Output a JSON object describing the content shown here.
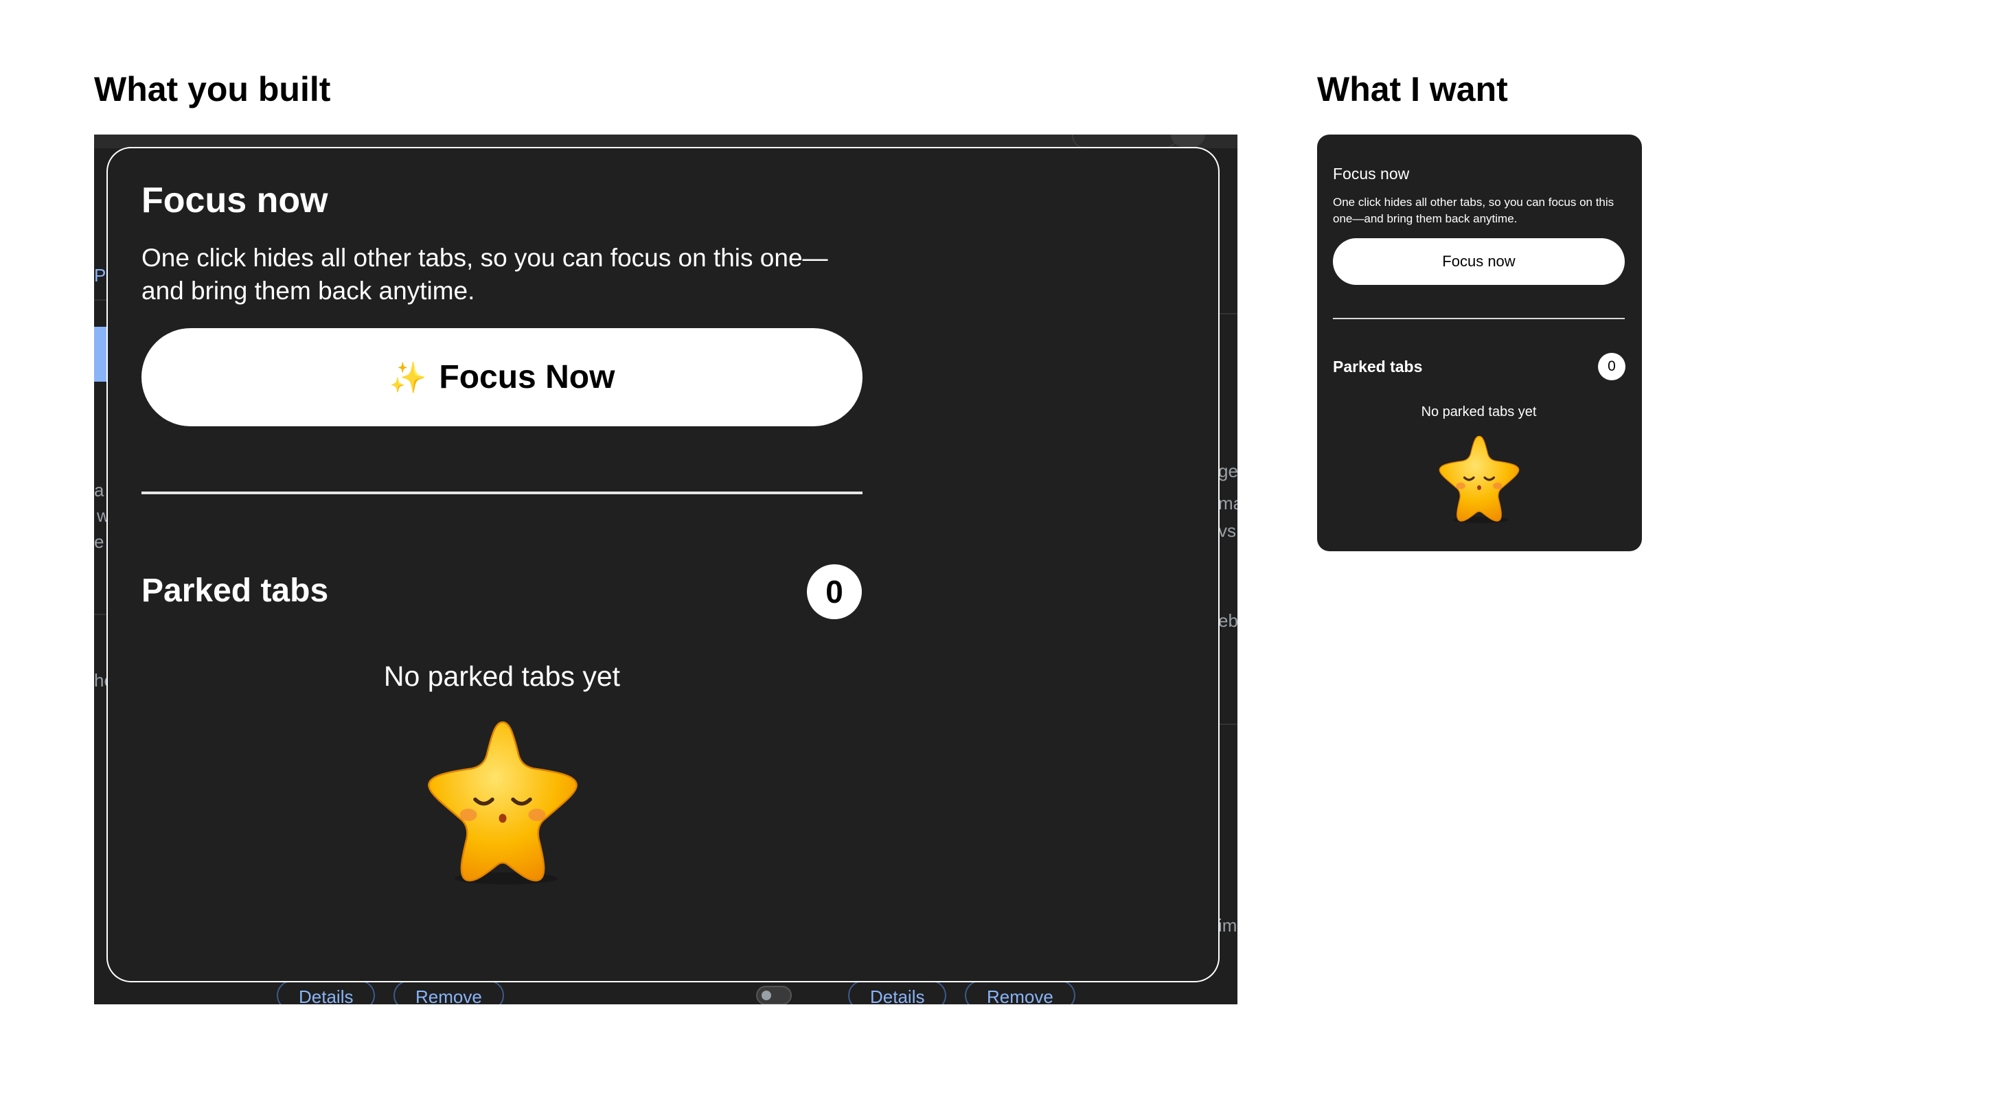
{
  "headings": {
    "left": "What you built",
    "right": "What I want"
  },
  "built_popup": {
    "title": "Focus now",
    "description": "One click hides all other tabs, so you can focus on this one—and bring them back anytime.",
    "button_icon": "✨",
    "button_label": "Focus Now",
    "parked_title": "Parked tabs",
    "parked_count": "0",
    "empty_text": "No parked tabs yet",
    "mascot_icon": "sleeping-star-icon"
  },
  "wanted_popup": {
    "title": "Focus now",
    "description": "One click hides all other tabs, so you can focus on this one—and bring them back anytime.",
    "button_label": "Focus now",
    "parked_title": "Parked tabs",
    "parked_count": "0",
    "empty_text": "No parked tabs yet",
    "mascot_icon": "sleeping-star-icon"
  },
  "background_page": {
    "fragments": [
      "Pa",
      "a",
      "w",
      "e",
      "he",
      "ge",
      "ma",
      "vs",
      "eb",
      "im"
    ],
    "buttons": [
      "Details",
      "Remove",
      "Details",
      "Remove"
    ]
  },
  "colors": {
    "panel_bg": "#202020",
    "button_bg": "#ffffff",
    "star_fill": "#fcb900",
    "link_blue": "#8ab4f8"
  }
}
